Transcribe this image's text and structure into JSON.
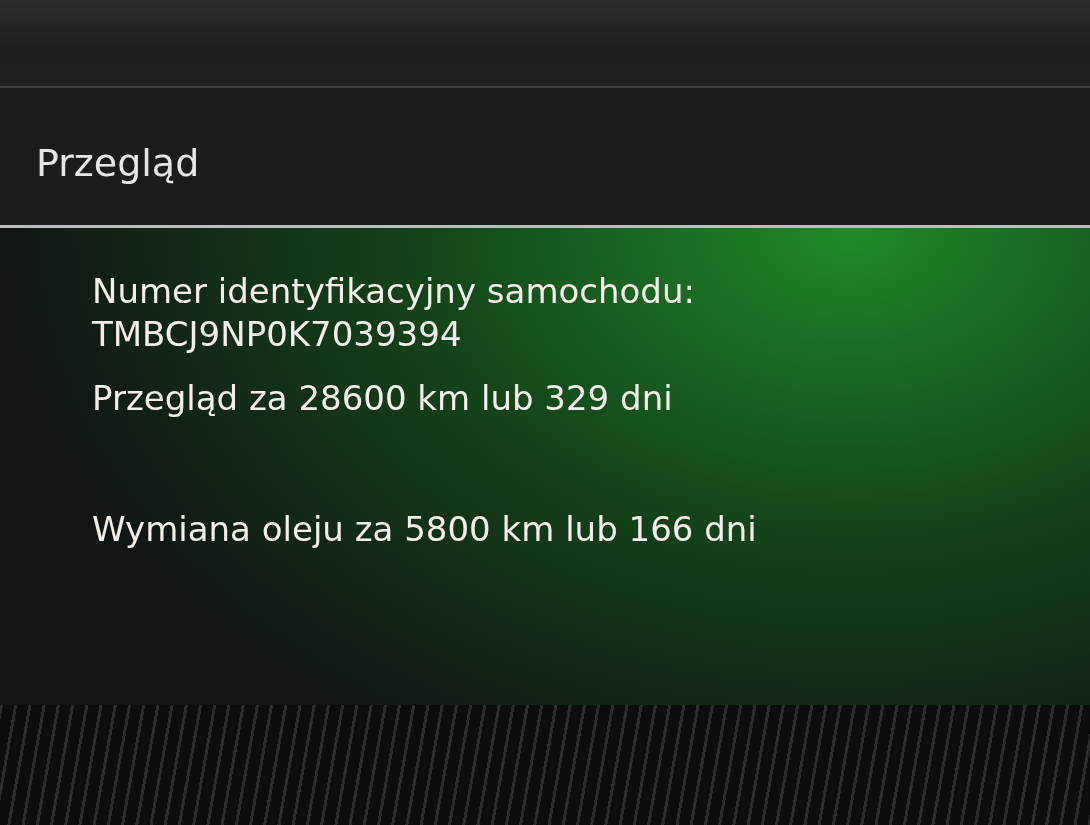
{
  "header": {
    "title": "Przegląd"
  },
  "overview": {
    "vin_label": "Numer identyfikacyjny samochodu:",
    "vin": "TMBCJ9NP0K7039394",
    "service": "Przegląd za 28600 km lub 329 dni",
    "oil_change": "Wymiana oleju za 5800 km lub 166 dni"
  }
}
